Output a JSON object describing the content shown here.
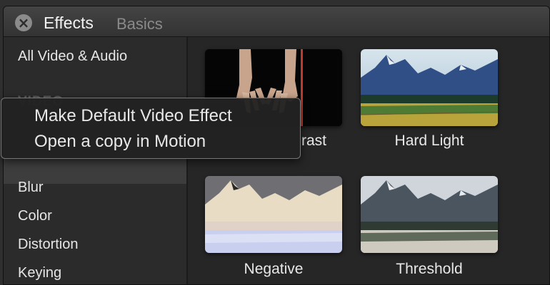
{
  "header": {
    "title": "Effects",
    "tab_basics": "Basics",
    "close_glyph": "×"
  },
  "sidebar": {
    "items": [
      {
        "label": "All Video & Audio"
      },
      {
        "label": "Blur"
      },
      {
        "label": "Color"
      },
      {
        "label": "Distortion"
      },
      {
        "label": "Keying"
      }
    ],
    "section_video": "VIDEO"
  },
  "effects": [
    {
      "label": "Contrast",
      "visible_label": "rast",
      "icon": "hands-thumbnail"
    },
    {
      "label": "Hard Light",
      "icon": "mountain-landscape-thumbnail"
    },
    {
      "label": "Negative",
      "icon": "negative-landscape-thumbnail"
    },
    {
      "label": "Threshold",
      "icon": "threshold-landscape-thumbnail"
    }
  ],
  "context_menu": {
    "items": [
      {
        "label": "Make Default Video Effect"
      },
      {
        "label": "Open a copy in Motion"
      }
    ]
  },
  "colors": {
    "background": "#2a2a2a",
    "sidebar": "#2b2b2b",
    "selected_row": "#3d3d3d",
    "text": "#e6e6e6"
  }
}
